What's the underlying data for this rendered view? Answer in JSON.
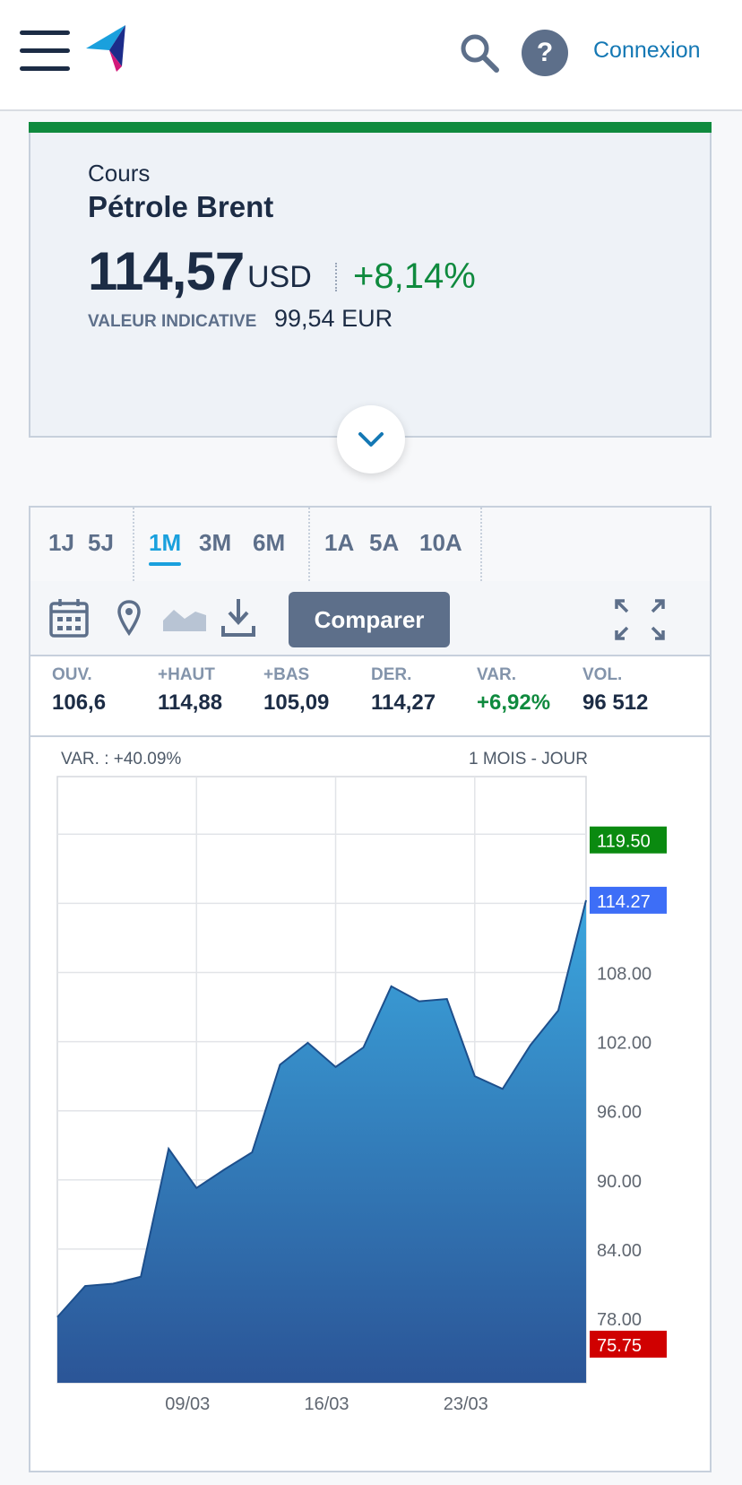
{
  "header": {
    "login_label": "Connexion",
    "help_glyph": "?",
    "icons": [
      "menu-icon",
      "logo-icon",
      "search-icon",
      "help-icon"
    ]
  },
  "quote": {
    "type_label": "Cours",
    "name": "Pétrole Brent",
    "price": "114,57",
    "currency": "USD",
    "change": "+8,14%",
    "indicative_label": "VALEUR INDICATIVE",
    "indicative_value": "99,54 EUR",
    "accent_color": "#0f8a3e"
  },
  "periods": [
    "1J",
    "5J",
    "1M",
    "3M",
    "6M",
    "1A",
    "5A",
    "10A"
  ],
  "active_period": "1M",
  "toolbar": {
    "compare_label": "Comparer",
    "icons": [
      "calendar-icon",
      "location-pin-icon",
      "area-chart-icon",
      "download-icon",
      "fullscreen-icon"
    ]
  },
  "stats": [
    {
      "label": "OUV.",
      "value": "106,6"
    },
    {
      "label": "+HAUT",
      "value": "114,88"
    },
    {
      "label": "+BAS",
      "value": "105,09"
    },
    {
      "label": "DER.",
      "value": "114,27"
    },
    {
      "label": "VAR.",
      "value": "+6,92%"
    },
    {
      "label": "VOL.",
      "value": "96 512"
    }
  ],
  "chart_data": {
    "type": "area",
    "var_label": "VAR. : +40.09%",
    "period_label": "1 MOIS - JOUR",
    "x_ticks": [
      "09/03",
      "16/03",
      "23/03"
    ],
    "y_ticks": [
      "78.00",
      "84.00",
      "90.00",
      "96.00",
      "102.00",
      "108.00"
    ],
    "ylim": [
      72.4,
      125
    ],
    "grid": true,
    "series": [
      {
        "values": [
          78.1,
          80.8,
          81.0,
          81.6,
          92.7,
          89.3,
          90.9,
          92.4,
          100.0,
          101.9,
          99.8,
          101.5,
          106.8,
          105.5,
          105.7,
          99.0,
          97.9,
          101.7,
          104.7,
          114.27
        ]
      }
    ],
    "markers": [
      {
        "label": "119.50",
        "value": 119.5,
        "color": "#0a8a10"
      },
      {
        "label": "114.27",
        "value": 114.27,
        "color": "#3d6ef7"
      },
      {
        "label": "75.75",
        "value": 75.75,
        "color": "#d00000"
      }
    ]
  }
}
